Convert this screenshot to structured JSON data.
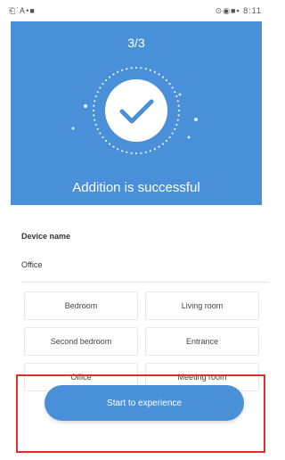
{
  "status_bar": {
    "left_text": "⎗˙Ꭺ•■",
    "right_text": "⊙◉■▪ 8:11"
  },
  "hero": {
    "step": "3/3",
    "message": "Addition is successful",
    "accent": "#4a90d9"
  },
  "device": {
    "label": "Device name",
    "value": "Office"
  },
  "room_options": [
    "Bedroom",
    "Living room",
    "Second bedroom",
    "Entrance",
    "Office",
    "Meeting room"
  ],
  "actions": {
    "start_label": "Start to experience"
  },
  "highlight_color": "#e0302a"
}
